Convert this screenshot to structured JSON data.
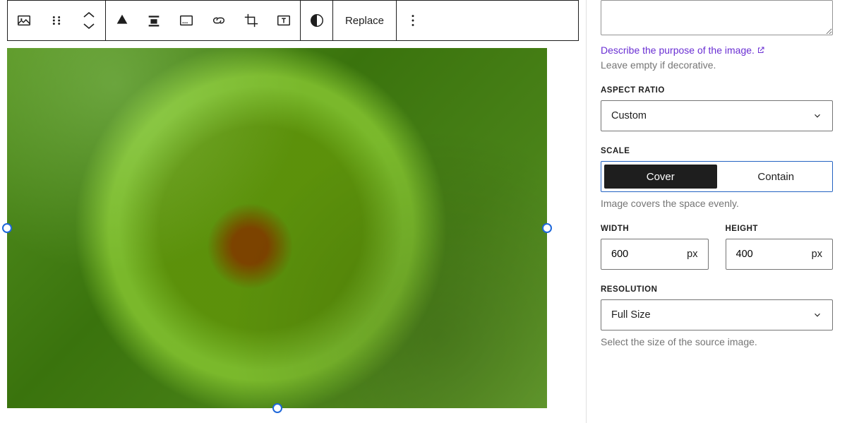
{
  "toolbar": {
    "replace_label": "Replace"
  },
  "sidebar": {
    "describe_link": "Describe the purpose of the image.",
    "decorative_hint": "Leave empty if decorative.",
    "aspect_ratio": {
      "label": "ASPECT RATIO",
      "value": "Custom"
    },
    "scale": {
      "label": "SCALE",
      "options": [
        "Cover",
        "Contain"
      ],
      "active": "Cover",
      "description": "Image covers the space evenly."
    },
    "width": {
      "label": "WIDTH",
      "value": "600",
      "unit": "px"
    },
    "height": {
      "label": "HEIGHT",
      "value": "400",
      "unit": "px"
    },
    "resolution": {
      "label": "RESOLUTION",
      "value": "Full Size",
      "description": "Select the size of the source image."
    }
  }
}
